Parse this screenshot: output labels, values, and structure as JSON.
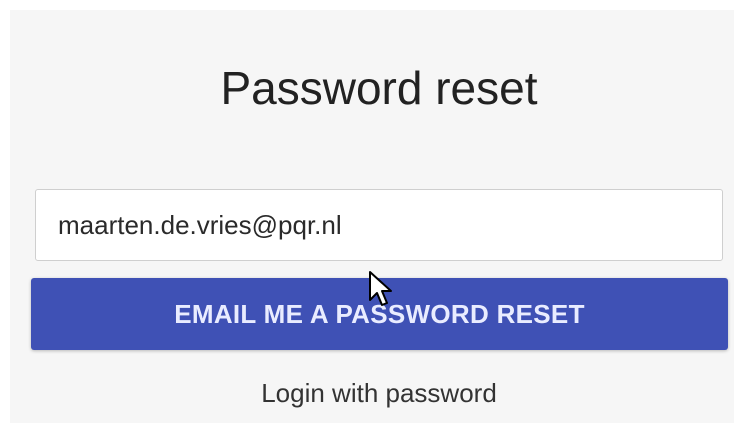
{
  "form": {
    "title": "Password reset",
    "email_value": "maarten.de.vries@pqr.nl",
    "submit_label": "EMAIL ME A PASSWORD RESET",
    "login_link_label": "Login with password"
  },
  "colors": {
    "primary": "#3f51b5",
    "panel_background": "#f6f6f6"
  },
  "icons": {
    "cursor": "mouse-pointer-icon"
  }
}
